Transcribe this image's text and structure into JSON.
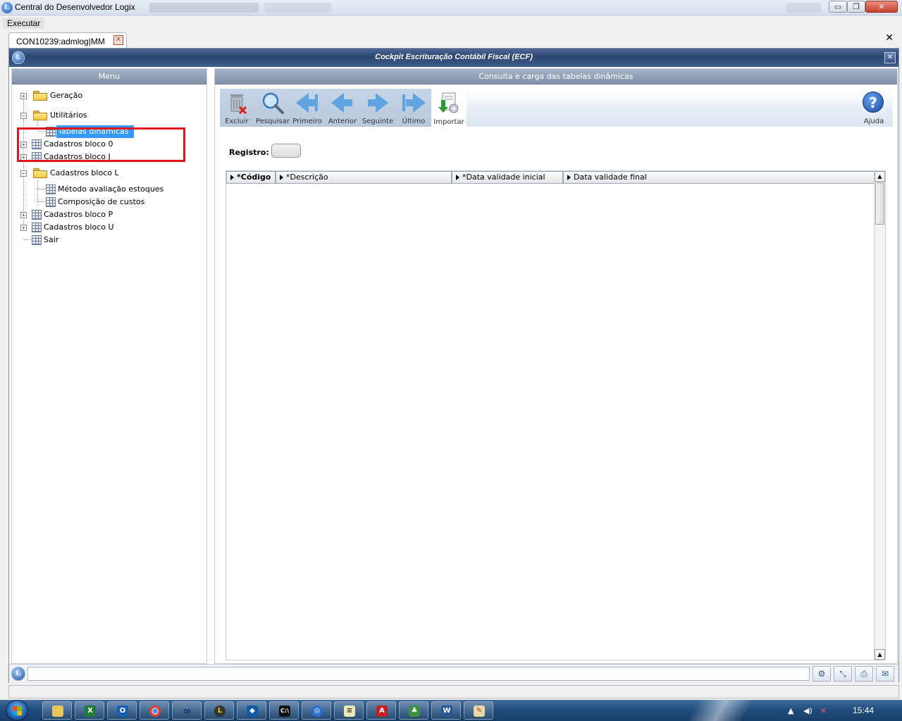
{
  "window": {
    "title": "Central do Desenvolvedor Logix",
    "minimize": "▭",
    "restore": "❐",
    "close": "✕"
  },
  "menubar": {
    "executar": "Executar"
  },
  "tabs": [
    {
      "label": "CON10239:admlog|MM",
      "close": "✕"
    }
  ],
  "close_all": "✕",
  "app": {
    "title": "Cockpit Escrituração Contábil Fiscal (ECF)",
    "close": "✕",
    "logo": "L"
  },
  "menu_panel": {
    "header": "Menu",
    "items": [
      {
        "label": "Geração",
        "type": "folder",
        "expander": "+"
      },
      {
        "label": "Utilitários",
        "type": "folder",
        "expander": "−"
      },
      {
        "label": "Tabelas dinâmicas",
        "type": "table",
        "selected": true
      },
      {
        "label": "Cadastros bloco 0",
        "type": "table",
        "expander": "+"
      },
      {
        "label": "Cadastros bloco J",
        "type": "table",
        "expander": "+"
      },
      {
        "label": "Cadastros bloco L",
        "type": "folder",
        "expander": "−"
      },
      {
        "label": "Método avaliação estoques",
        "type": "table"
      },
      {
        "label": "Composição de custos",
        "type": "table"
      },
      {
        "label": "Cadastros bloco P",
        "type": "table",
        "expander": "+"
      },
      {
        "label": "Cadastros bloco U",
        "type": "table",
        "expander": "+"
      },
      {
        "label": "Sair",
        "type": "table"
      }
    ]
  },
  "content": {
    "header": "Consulta e carga das tabelas dinâmicas",
    "toolbar": {
      "excluir": "Excluir",
      "pesquisar": "Pesquisar",
      "primeiro": "Primeiro",
      "anterior": "Anterior",
      "seguinte": "Seguinte",
      "ultimo": "Último",
      "importar": "Importar",
      "ajuda": "Ajuda",
      "help_glyph": "?"
    },
    "registro_label": "Registro:",
    "registro_value": "",
    "columns": [
      "*Código",
      "*Descrição",
      "*Data validade inicial",
      "Data validade final"
    ],
    "rows": []
  },
  "taskbar": {
    "clock": "15:44",
    "apps": [
      "explorer",
      "excel",
      "outlook",
      "chrome",
      "infinity",
      "logix",
      "teamviewer",
      "cmd",
      "globe",
      "notepad",
      "acrobat",
      "tree",
      "word",
      "paint"
    ]
  }
}
